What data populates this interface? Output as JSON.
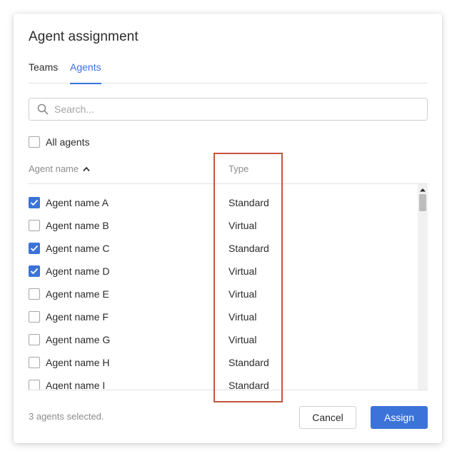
{
  "dialog": {
    "title": "Agent assignment"
  },
  "tabs": [
    {
      "label": "Teams",
      "active": false
    },
    {
      "label": "Agents",
      "active": true
    }
  ],
  "search": {
    "placeholder": "Search...",
    "value": ""
  },
  "all_agents": {
    "label": "All agents",
    "checked": false
  },
  "columns": {
    "name": "Agent name",
    "type": "Type"
  },
  "agents": [
    {
      "name": "Agent name A",
      "type": "Standard",
      "checked": true
    },
    {
      "name": "Agent name B",
      "type": "Virtual",
      "checked": false
    },
    {
      "name": "Agent name C",
      "type": "Standard",
      "checked": true
    },
    {
      "name": "Agent name D",
      "type": "Virtual",
      "checked": true
    },
    {
      "name": "Agent name E",
      "type": "Virtual",
      "checked": false
    },
    {
      "name": "Agent name F",
      "type": "Virtual",
      "checked": false
    },
    {
      "name": "Agent name G",
      "type": "Virtual",
      "checked": false
    },
    {
      "name": "Agent name H",
      "type": "Standard",
      "checked": false
    },
    {
      "name": "Agent name I",
      "type": "Standard",
      "checked": false
    }
  ],
  "footer": {
    "status": "3 agents selected.",
    "cancel_label": "Cancel",
    "assign_label": "Assign"
  },
  "colors": {
    "accent": "#3b73d8",
    "highlight": "#c5543f",
    "muted_text": "#8c8c8c"
  }
}
